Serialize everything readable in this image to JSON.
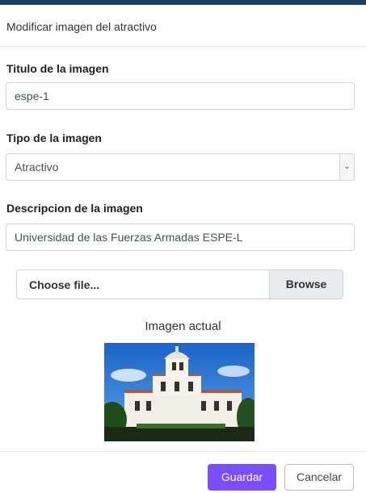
{
  "modal": {
    "title": "Modificar imagen del atractivo"
  },
  "form": {
    "title_label": "Titulo de la imagen",
    "title_value": "espe-1",
    "type_label": "Tipo de la imagen",
    "type_value": "Atractivo",
    "type_arrow_icon": "chevron-down",
    "description_label": "Descripcion de la imagen",
    "description_value": "Universidad de las Fuerzas Armadas ESPE-L",
    "file_placeholder": "Choose file...",
    "browse_label": "Browse"
  },
  "preview": {
    "caption": "Imagen actual"
  },
  "footer": {
    "save_label": "Guardar",
    "cancel_label": "Cancelar"
  },
  "colors": {
    "header_bar": "#1d3f66",
    "primary_button": "#7c4dff"
  }
}
